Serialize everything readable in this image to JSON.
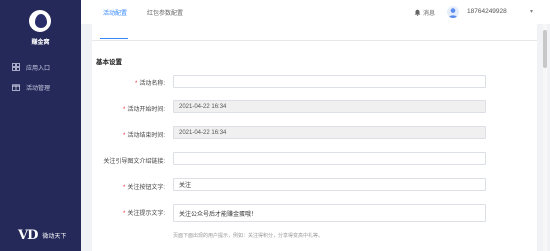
{
  "sidebar": {
    "logo_text": "赚金窝",
    "items": [
      {
        "label": "应用入口",
        "icon": "grid-icon"
      },
      {
        "label": "活动管理",
        "icon": "gift-icon"
      }
    ],
    "brand_mark": "VD",
    "brand_text": "微动天下",
    "bg_color": "#25295a"
  },
  "topbar": {
    "notice_label": "消息",
    "phone": "18764249928",
    "caret": "▾"
  },
  "tabs": [
    {
      "label": "活动配置",
      "active": true
    },
    {
      "label": "红包参数配置",
      "active": false
    }
  ],
  "section_title": "基本设置",
  "form": {
    "fields": [
      {
        "label": "活动名称:",
        "required": true,
        "value": ""
      },
      {
        "label": "活动开始时间:",
        "required": true,
        "value": "2021-04-22 16:34"
      },
      {
        "label": "活动结束时间:",
        "required": true,
        "value": "2021-04-22 16:34"
      },
      {
        "label": "关注引导图文介绍链接:",
        "required": false,
        "value": ""
      },
      {
        "label": "关注按钮文字:",
        "required": true,
        "value": "关注"
      },
      {
        "label": "关注提示文字:",
        "required": true,
        "value": "关注公众号后才能赚金蛋哦！"
      }
    ],
    "hint": "页面下面出现的用户提示，例如：关注得积分，分享得变高中礼等。"
  },
  "accent_color": "#3388ff"
}
